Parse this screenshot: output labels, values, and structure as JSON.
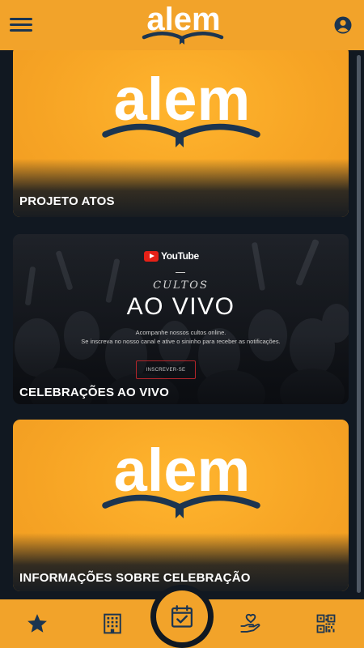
{
  "header": {
    "brand": "alem",
    "menu_icon": "hamburger-menu-icon",
    "account_icon": "user-circle-icon"
  },
  "feed": {
    "cards": [
      {
        "title": "PROJETO ATOS",
        "image": "alem-logo-banner"
      },
      {
        "title": "CELEBRAÇÕES AO VIVO",
        "image": "youtube-cultos-banner",
        "banner": {
          "platform": "YouTube",
          "kicker": "CULTOS",
          "headline": "AO VIVO",
          "line1": "Acompanhe nossos cultos online.",
          "line2": "Se inscreva no nosso canal e ative o sininho para receber as notificações.",
          "button": "INSCREVER-SE"
        }
      },
      {
        "title": "INFORMAÇÕES SOBRE CELEBRAÇÃO",
        "image": "alem-logo-banner"
      }
    ]
  },
  "bottom_nav": {
    "items": [
      {
        "icon": "star-icon",
        "active": false
      },
      {
        "icon": "building-icon",
        "active": false
      },
      {
        "icon": "calendar-check-icon",
        "active": true
      },
      {
        "icon": "heart-hand-icon",
        "active": false
      },
      {
        "icon": "qr-code-icon",
        "active": false
      }
    ]
  },
  "colors": {
    "accent": "#F2A32A",
    "navy": "#1C3550",
    "background": "#111821",
    "youtube_red": "#E62117"
  }
}
